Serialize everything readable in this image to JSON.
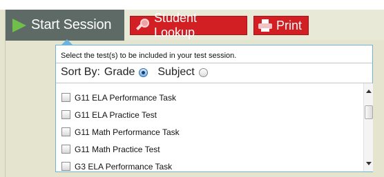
{
  "toolbar": {
    "start_session_label": "Start Session",
    "student_lookup_label": "Student Lookup",
    "print_label": "Print",
    "colors": {
      "session_bg": "#5e6a66",
      "play_icon": "#6fbf4a",
      "action_red": "#d21f24"
    },
    "icons": {
      "start": "play-icon",
      "lookup": "magnifier-icon",
      "print": "printer-icon"
    }
  },
  "test_panel": {
    "instructions": "Select the test(s) to be included in your test session.",
    "sort_by_label": "Sort By:",
    "sort_options": [
      {
        "label": "Grade",
        "selected": true
      },
      {
        "label": "Subject",
        "selected": false
      }
    ],
    "tests": [
      {
        "label": "G11 ELA Performance Task",
        "checked": false
      },
      {
        "label": "G11 ELA Practice Test",
        "checked": false
      },
      {
        "label": "G11 Math Performance Task",
        "checked": false
      },
      {
        "label": "G11 Math Practice Test",
        "checked": false
      },
      {
        "label": "G3 ELA Performance Task",
        "checked": false
      }
    ],
    "colors": {
      "border": "#6eb3dd"
    }
  }
}
